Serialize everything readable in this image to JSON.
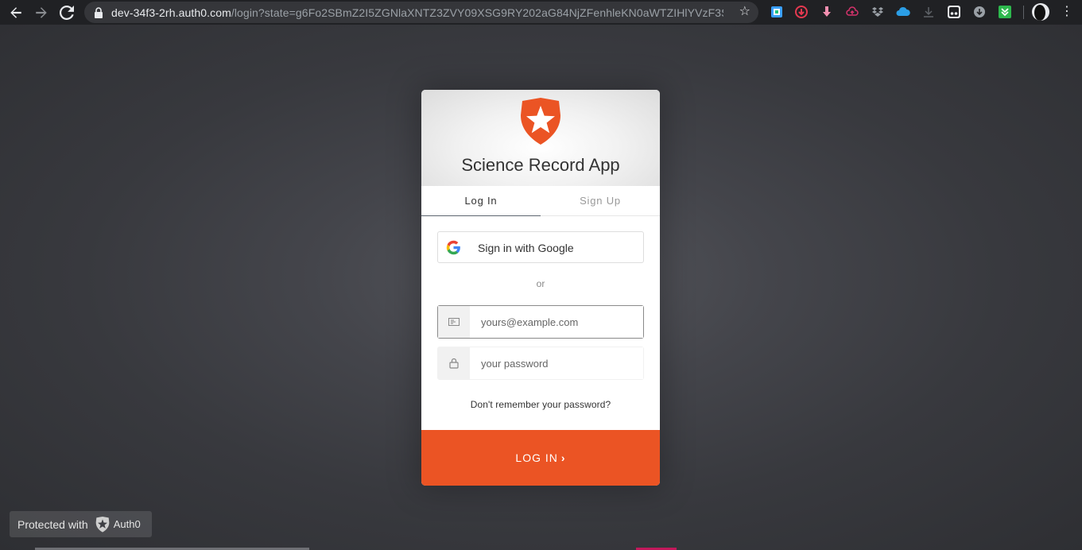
{
  "browser": {
    "url_host": "dev-34f3-2rh.auth0.com",
    "url_path": "/login?state=g6Fo2SBmZ2I5ZGNlaXNTZ3ZVY09XSG9RY202aG84NjZFenhleKN0aWTZIHlYVzF3SVdo...",
    "back_icon": "arrow-left-icon",
    "forward_icon": "arrow-right-icon",
    "reload_icon": "reload-icon",
    "bookmark_icon": "star-icon"
  },
  "card": {
    "title": "Science Record App",
    "tabs": [
      {
        "label": "Log In",
        "active": true
      },
      {
        "label": "Sign Up",
        "active": false
      }
    ],
    "social_label": "Sign in with Google",
    "or_text": "or",
    "email_placeholder": "yours@example.com",
    "password_placeholder": "your password",
    "forgot_label": "Don't remember your password?",
    "submit_label": "LOG IN",
    "submit_chevron": "›"
  },
  "footer": {
    "protected_text": "Protected with",
    "brand": "Auth0"
  },
  "colors": {
    "accent": "#eb5424",
    "chrome": "#202124",
    "page_bg": "#3f4045"
  }
}
